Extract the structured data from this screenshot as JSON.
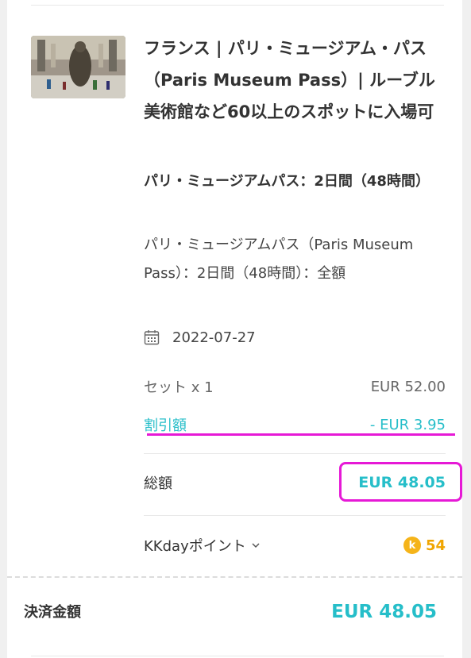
{
  "product": {
    "title": "フランス | パリ・ミュージアム・パス（Paris Museum Pass）| ルーブル美術館など60以上のスポットに入場可",
    "package_name": "パリ・ミュージアムパス：2日間（48時間）",
    "package_desc": "パリ・ミュージアムパス（Paris Museum Pass）：2日間（48時間）：全額",
    "date": "2022-07-27",
    "date_icon": "calendar-icon",
    "image_icon": "museum-photo"
  },
  "pricing": {
    "sets_label": "セット x 1",
    "sets_value": "EUR 52.00",
    "discount_label": "割引額",
    "discount_value": "- EUR 3.95",
    "total_label": "総額",
    "total_value": "EUR 48.05"
  },
  "points": {
    "label": "KKdayポイント",
    "coin_letter": "k",
    "value": "54"
  },
  "payment": {
    "label": "決済金額",
    "value": "EUR 48.05"
  },
  "colors": {
    "accent": "#26bec9",
    "highlight": "#e619d6",
    "coin": "#f5b41a"
  }
}
